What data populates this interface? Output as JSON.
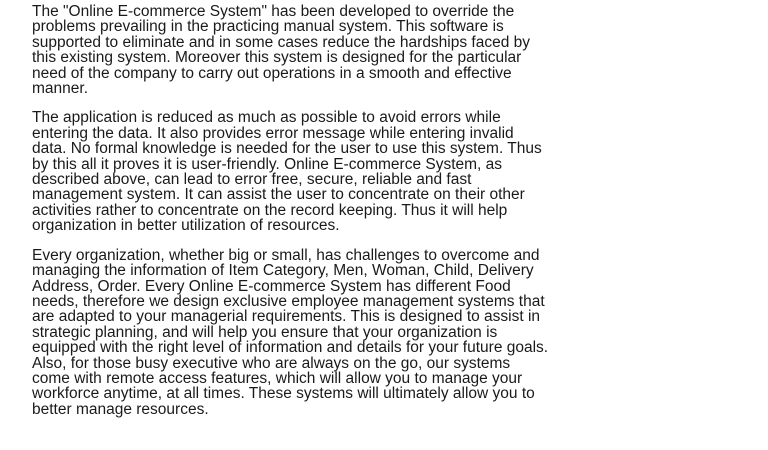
{
  "document": {
    "paragraphs": [
      {
        "lines": [
          "The \"Online E-commerce System\" has been developed to override the",
          "problems prevailing in the practicing manual system. This software is",
          "supported to eliminate and in some cases reduce the hardships faced by",
          "this existing system. Moreover this system is designed for the particular",
          "need of the company to carry out operations in a smooth and effective",
          "manner."
        ]
      },
      {
        "lines": [
          "The application is reduced as much as possible to avoid errors while",
          "entering the data. It also provides error message while entering invalid",
          "data. No formal knowledge is needed for the user to use this system. Thus",
          "by this all it proves it is user-friendly. Online E-commerce System, as",
          "described above, can lead to error free, secure, reliable and fast",
          "management system. It can assist the user to concentrate on their other",
          "activities rather to concentrate on the record keeping. Thus it will help",
          "organization in better utilization of resources."
        ]
      },
      {
        "lines": [
          "Every organization, whether big or small, has challenges to overcome and",
          "managing the information of Item Category, Men, Woman, Child, Delivery",
          "Address, Order. Every Online E-commerce System has different Food",
          "needs, therefore we design exclusive employee management systems that",
          "are adapted to your managerial requirements. This is designed to assist in",
          "strategic planning, and will help you ensure that your organization is",
          "equipped with the right level of information and details for your future goals.",
          "Also, for those busy executive who are always on the go, our systems",
          "come with remote access features, which will allow you to manage your",
          "workforce anytime, at all times. These systems will ultimately allow you to",
          "better manage resources."
        ]
      }
    ]
  }
}
